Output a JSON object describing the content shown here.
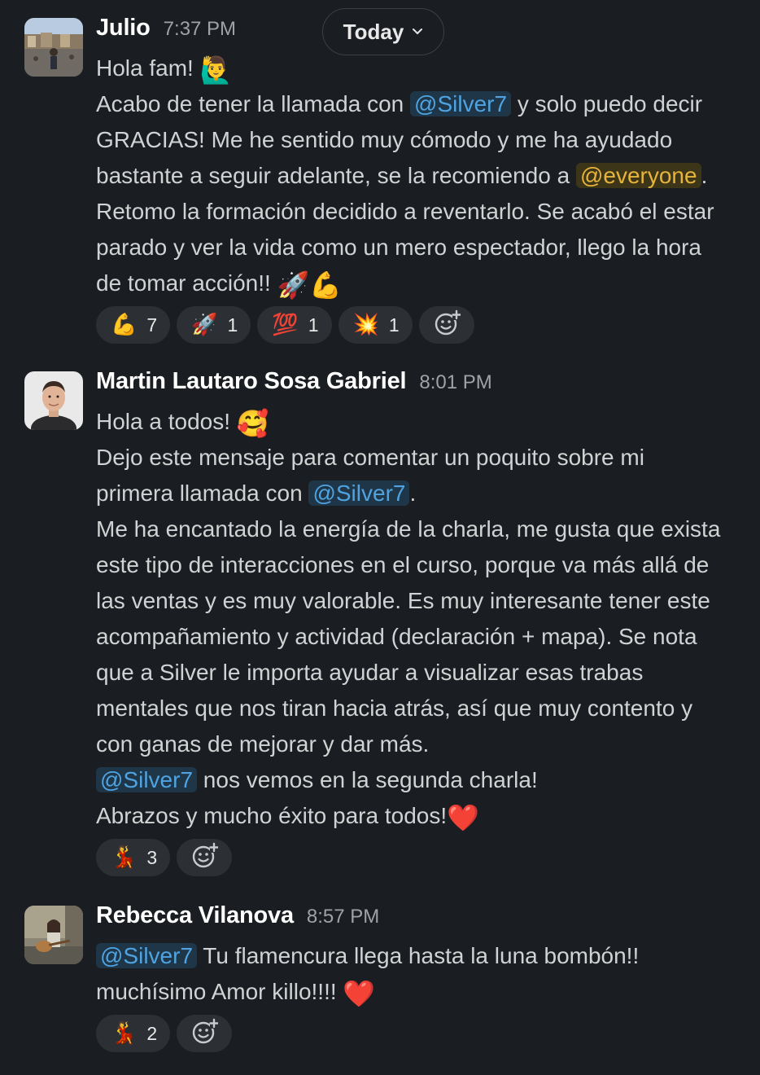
{
  "date_divider": {
    "label": "Today",
    "chevron_icon": "chevron-down-icon"
  },
  "messages": [
    {
      "sender": "Julio",
      "time": "7:37 PM",
      "lines": [
        {
          "parts": [
            {
              "t": "Hola fam! "
            },
            {
              "e": "🙋‍♂️"
            }
          ]
        },
        {
          "parts": [
            {
              "t": "Acabo de tener la llamada con "
            },
            {
              "m": "@Silver7"
            },
            {
              "t": " y solo puedo decir"
            }
          ]
        },
        {
          "parts": [
            {
              "t": "GRACIAS! Me he sentido muy cómodo y me ha ayudado"
            }
          ]
        },
        {
          "parts": [
            {
              "t": "bastante a seguir adelante, se la recomiendo a "
            },
            {
              "ma": "@everyone"
            },
            {
              "t": "."
            }
          ]
        },
        {
          "parts": [
            {
              "t": "Retomo la formación decidido a reventarlo. Se acabó el estar"
            }
          ]
        },
        {
          "parts": [
            {
              "t": "parado y ver la vida como un mero espectador, llego la hora"
            }
          ]
        },
        {
          "parts": [
            {
              "t": "de tomar acción!! "
            },
            {
              "e": "🚀"
            },
            {
              "e": "💪"
            }
          ]
        }
      ],
      "reactions": [
        {
          "emoji": "💪",
          "count": "7"
        },
        {
          "emoji": "🚀",
          "count": "1"
        },
        {
          "emoji": "💯",
          "count": "1"
        },
        {
          "emoji": "💥",
          "count": "1"
        }
      ]
    },
    {
      "sender": "Martin Lautaro Sosa Gabriel",
      "time": "8:01 PM",
      "lines": [
        {
          "parts": [
            {
              "t": "Hola a todos! "
            },
            {
              "e": "🥰"
            }
          ]
        },
        {
          "parts": [
            {
              "t": "Dejo este mensaje para comentar un poquito sobre mi"
            }
          ]
        },
        {
          "parts": [
            {
              "t": "primera llamada con "
            },
            {
              "m": "@Silver7"
            },
            {
              "t": "."
            }
          ]
        },
        {
          "parts": [
            {
              "t": "Me ha encantado la energía de la charla, me gusta que exista"
            }
          ]
        },
        {
          "parts": [
            {
              "t": "este tipo de interacciones en el curso, porque va más allá de"
            }
          ]
        },
        {
          "parts": [
            {
              "t": "las ventas y es muy valorable. Es muy interesante tener este"
            }
          ]
        },
        {
          "parts": [
            {
              "t": "acompañamiento y actividad (declaración + mapa). Se nota"
            }
          ]
        },
        {
          "parts": [
            {
              "t": "que a Silver le importa ayudar a visualizar esas trabas"
            }
          ]
        },
        {
          "parts": [
            {
              "t": "mentales que nos tiran hacia atrás, así que muy contento y"
            }
          ]
        },
        {
          "parts": [
            {
              "t": "con ganas de mejorar y dar más."
            }
          ]
        },
        {
          "parts": [
            {
              "m": "@Silver7"
            },
            {
              "t": " nos vemos en la segunda charla!"
            }
          ]
        },
        {
          "parts": [
            {
              "t": "Abrazos y mucho éxito para todos!"
            },
            {
              "e": "❤️"
            }
          ]
        }
      ],
      "reactions": [
        {
          "emoji": "💃",
          "count": "3"
        }
      ]
    },
    {
      "sender": "Rebecca Vilanova",
      "time": "8:57 PM",
      "lines": [
        {
          "parts": [
            {
              "m": "@Silver7"
            },
            {
              "t": " Tu flamencura llega hasta la luna bombón!!"
            }
          ]
        },
        {
          "parts": [
            {
              "t": "muchísimo Amor killo!!!! "
            },
            {
              "e": "❤️"
            }
          ]
        }
      ],
      "reactions": [
        {
          "emoji": "💃",
          "count": "2"
        }
      ]
    }
  ],
  "add_reaction_icon": "add-reaction-icon"
}
